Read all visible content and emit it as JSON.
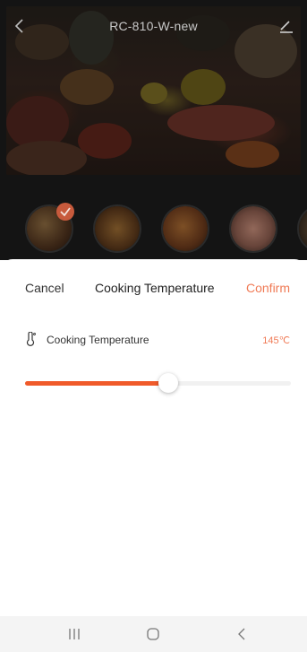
{
  "header": {
    "title": "RC-810-W-new",
    "back_icon": "chevron-left-icon",
    "edit_icon": "edit-icon"
  },
  "recipes": [
    {
      "name": "recipe-1",
      "selected": true,
      "color": "#8a5a3a"
    },
    {
      "name": "recipe-2",
      "selected": false,
      "color": "#a0683a"
    },
    {
      "name": "recipe-3",
      "selected": false,
      "color": "#b06a3a"
    },
    {
      "name": "recipe-4",
      "selected": false,
      "color": "#c88a6a"
    }
  ],
  "sheet": {
    "cancel_label": "Cancel",
    "title": "Cooking Temperature",
    "confirm_label": "Confirm",
    "setting_label": "Cooking Temperature",
    "setting_value": "145℃",
    "setting_icon": "thermometer-icon",
    "slider_fraction": 0.54
  },
  "colors": {
    "accent": "#f05a2a",
    "accent_text": "#f07a55",
    "badge": "#c75a3c"
  },
  "system_nav": {
    "recents_icon": "recents-icon",
    "home_icon": "home-icon",
    "back_icon": "back-icon"
  }
}
